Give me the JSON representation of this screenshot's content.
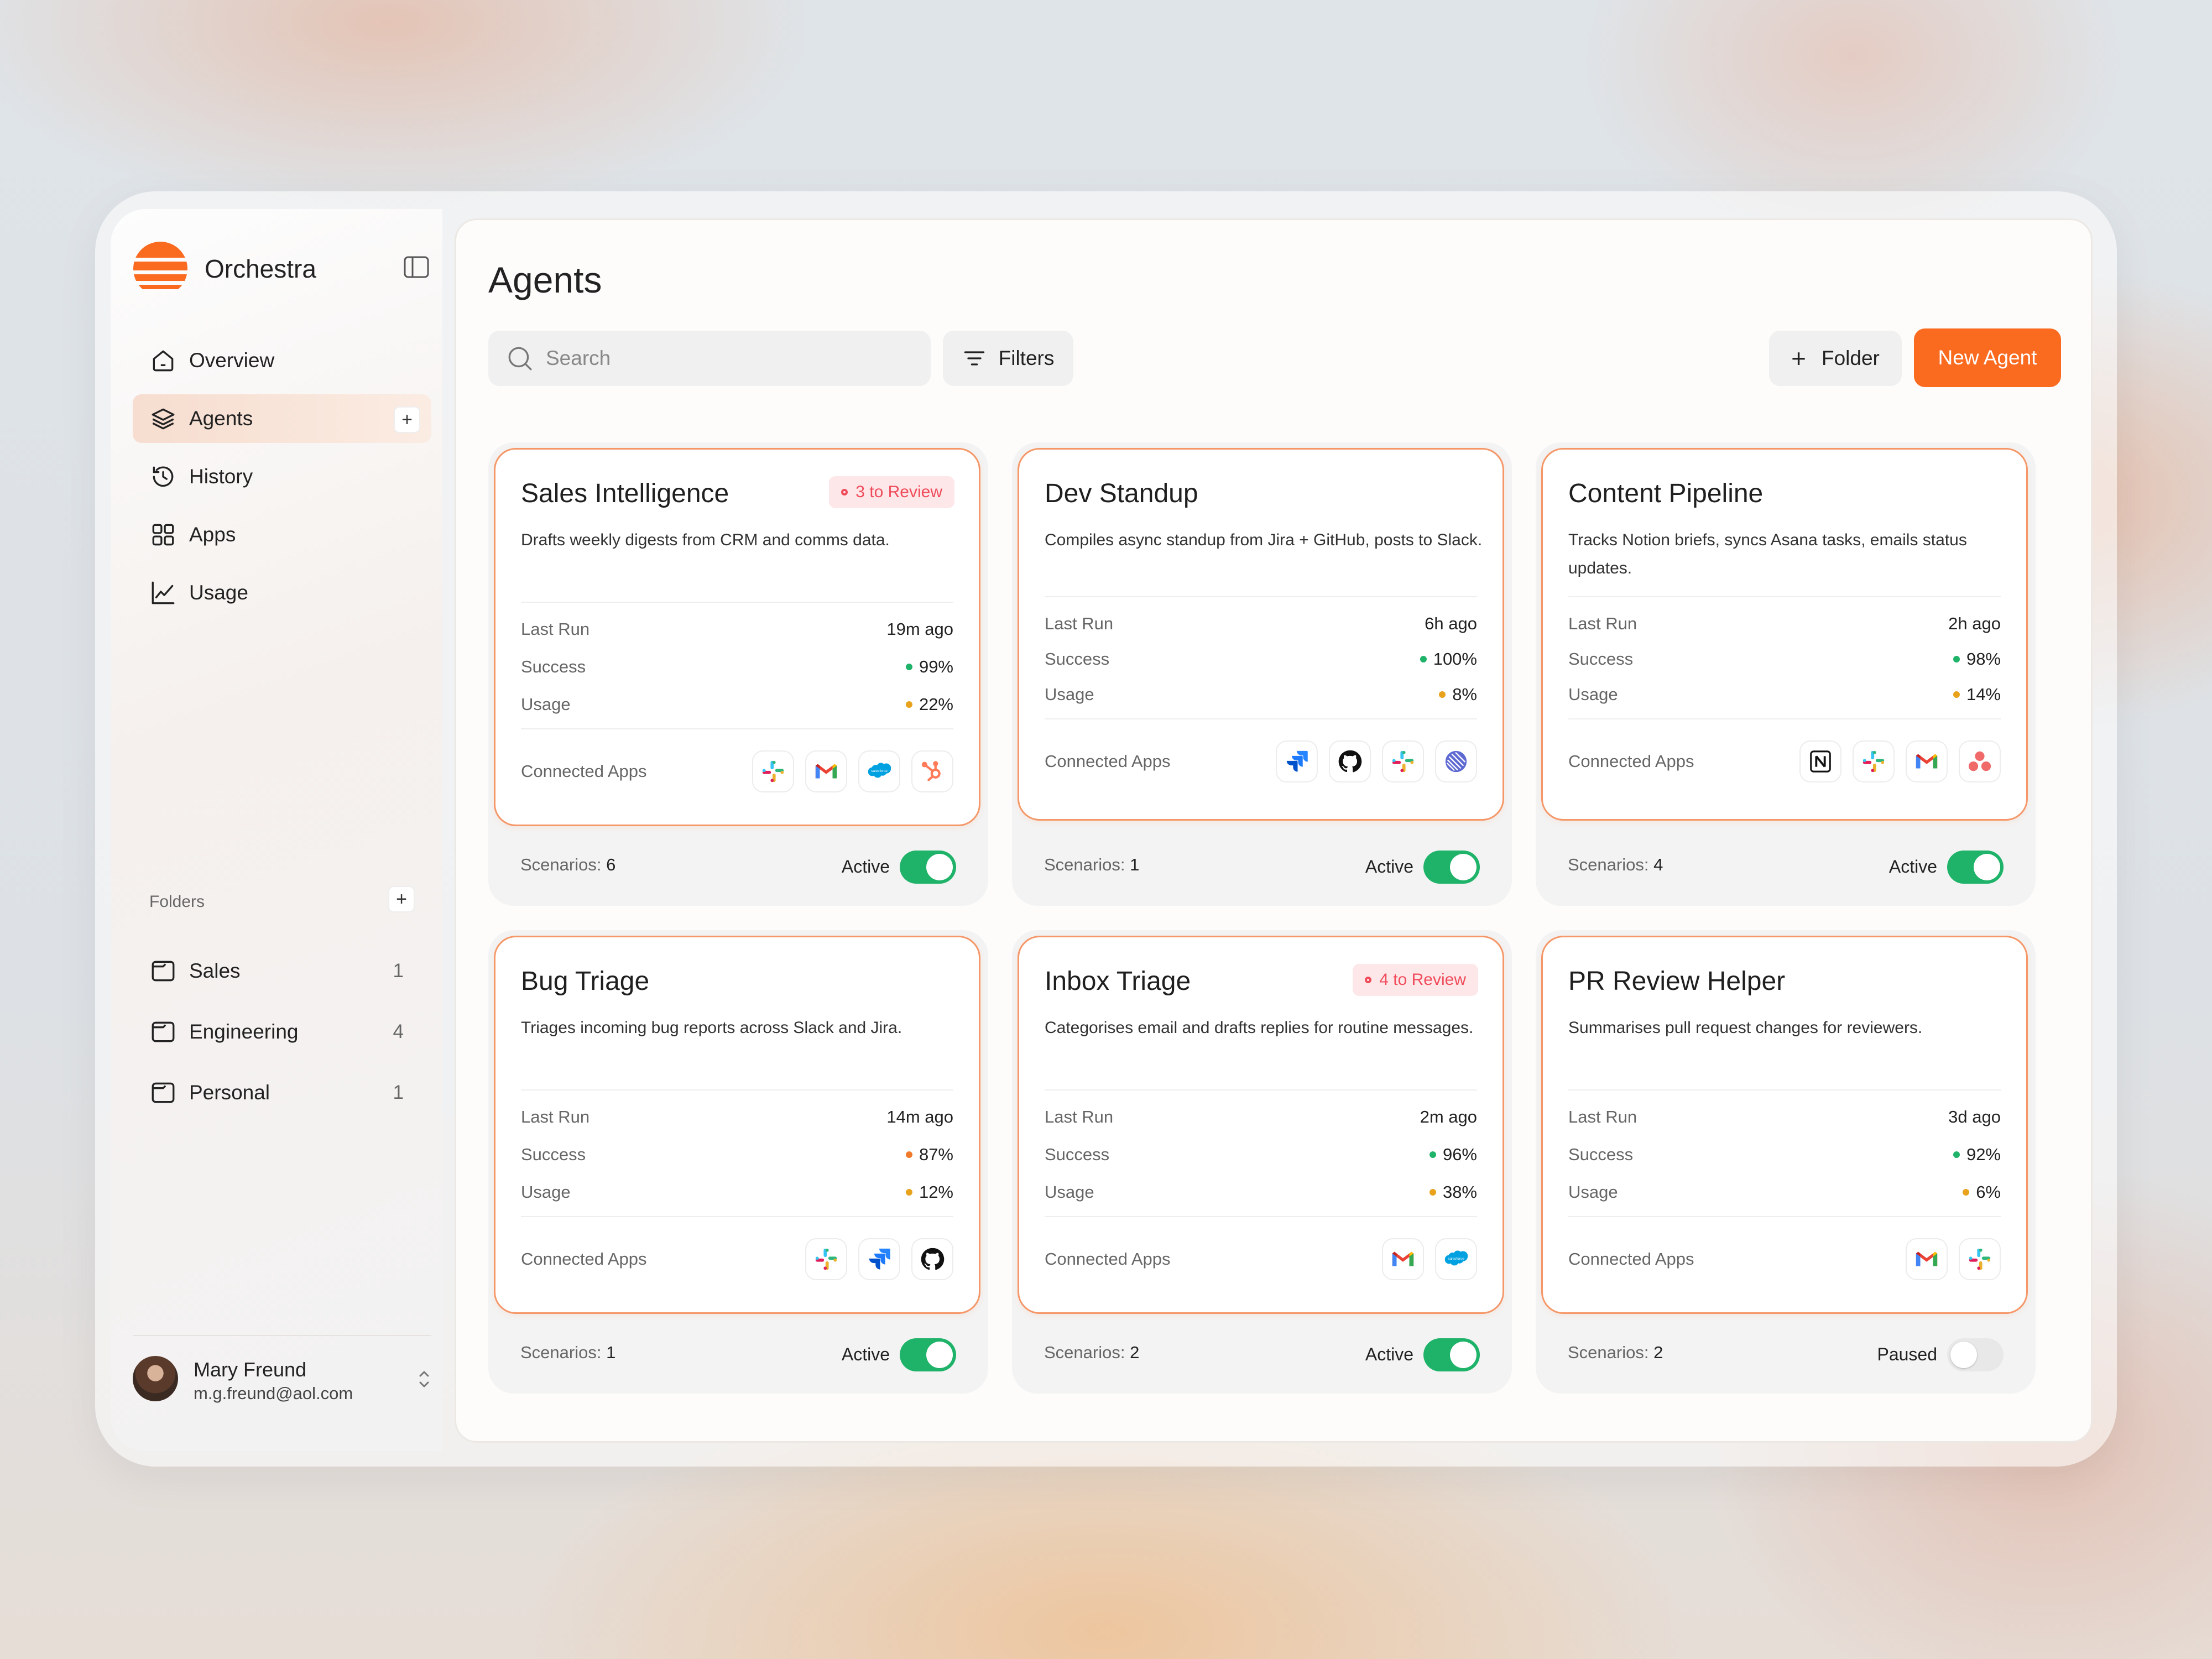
{
  "app": {
    "name": "Orchestra"
  },
  "sidebar": {
    "nav": [
      {
        "label": "Overview",
        "icon": "home-icon"
      },
      {
        "label": "Agents",
        "icon": "layers-icon",
        "active": true
      },
      {
        "label": "History",
        "icon": "history-icon"
      },
      {
        "label": "Apps",
        "icon": "grid-icon"
      },
      {
        "label": "Usage",
        "icon": "chart-icon"
      }
    ],
    "folders_header": "Folders",
    "folders": [
      {
        "label": "Sales",
        "count": "1"
      },
      {
        "label": "Engineering",
        "count": "4"
      },
      {
        "label": "Personal",
        "count": "1"
      }
    ],
    "user": {
      "name": "Mary Freund",
      "email": "m.g.freund@aol.com"
    }
  },
  "main": {
    "title": "Agents",
    "search_placeholder": "Search",
    "filters_label": "Filters",
    "folder_label": "Folder",
    "new_agent_label": "New Agent",
    "labels": {
      "last_run": "Last Run",
      "success": "Success",
      "usage": "Usage",
      "connected_apps": "Connected Apps",
      "scenarios": "Scenarios:"
    },
    "colors": {
      "accent": "#fa6a1f",
      "success_green": "#1fb36a",
      "usage_amber": "#e8a21c",
      "warning_orange": "#f07a2a",
      "review_red": "#f04b5b"
    },
    "agents": [
      {
        "name": "Sales Intelligence",
        "review": "3 to Review",
        "description": "Drafts weekly digests from CRM and comms data.",
        "last_run": "19m ago",
        "success": "99%",
        "success_color": "#1fb36a",
        "usage": "22%",
        "usage_color": "#e8a21c",
        "apps": [
          "slack",
          "gmail",
          "salesforce",
          "hubspot"
        ],
        "scenarios": "6",
        "status": "Active",
        "enabled": true
      },
      {
        "name": "Dev Standup",
        "review": "",
        "description": "Compiles async standup from Jira + GitHub, posts to Slack.",
        "last_run": "6h ago",
        "success": "100%",
        "success_color": "#1fb36a",
        "usage": "8%",
        "usage_color": "#e8a21c",
        "apps": [
          "jira",
          "github",
          "slack",
          "linear"
        ],
        "scenarios": "1",
        "status": "Active",
        "enabled": true
      },
      {
        "name": "Content Pipeline",
        "review": "",
        "description": "Tracks Notion briefs, syncs Asana tasks, emails status updates.",
        "last_run": "2h ago",
        "success": "98%",
        "success_color": "#1fb36a",
        "usage": "14%",
        "usage_color": "#e8a21c",
        "apps": [
          "notion",
          "slack",
          "gmail",
          "asana"
        ],
        "scenarios": "4",
        "status": "Active",
        "enabled": true
      },
      {
        "name": "Bug Triage",
        "review": "",
        "description": "Triages incoming bug reports across Slack and Jira.",
        "last_run": "14m ago",
        "success": "87%",
        "success_color": "#f07a2a",
        "usage": "12%",
        "usage_color": "#e8a21c",
        "apps": [
          "slack",
          "jira",
          "github"
        ],
        "scenarios": "1",
        "status": "Active",
        "enabled": true
      },
      {
        "name": "Inbox Triage",
        "review": "4 to Review",
        "description": "Categorises email and drafts replies for routine messages.",
        "last_run": "2m ago",
        "success": "96%",
        "success_color": "#1fb36a",
        "usage": "38%",
        "usage_color": "#e8a21c",
        "apps": [
          "gmail",
          "salesforce"
        ],
        "scenarios": "2",
        "status": "Active",
        "enabled": true
      },
      {
        "name": "PR Review Helper",
        "review": "",
        "description": "Summarises pull request changes for reviewers.",
        "last_run": "3d ago",
        "success": "92%",
        "success_color": "#1fb36a",
        "usage": "6%",
        "usage_color": "#e8a21c",
        "apps": [
          "gmail",
          "slack"
        ],
        "scenarios": "2",
        "status": "Paused",
        "enabled": false
      }
    ]
  }
}
